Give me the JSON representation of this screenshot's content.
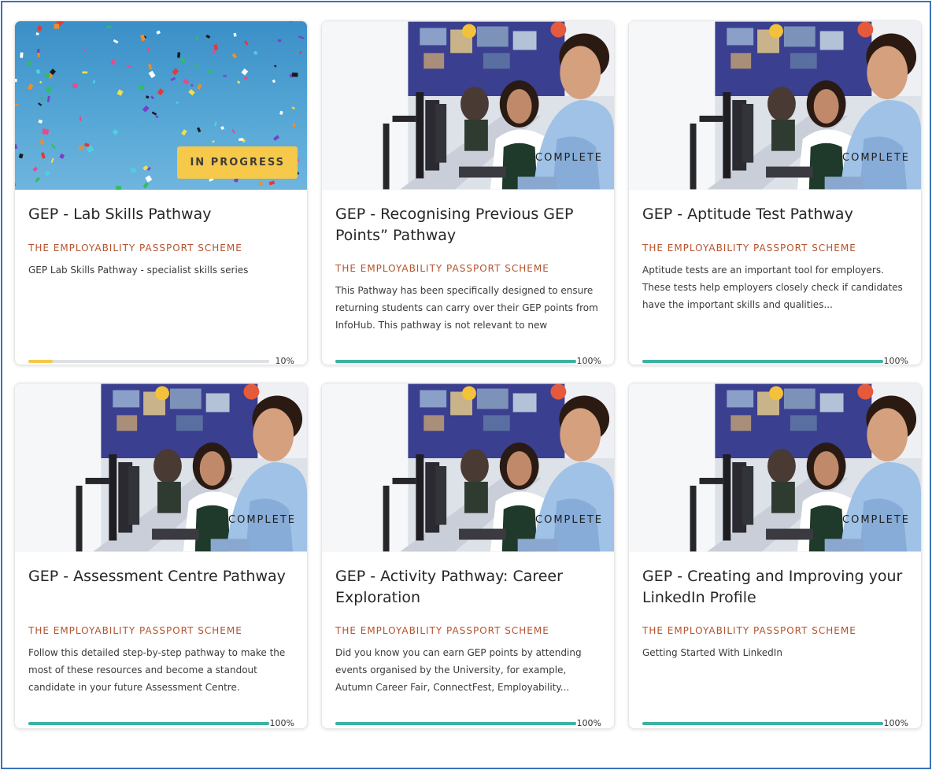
{
  "colors": {
    "progress_partial": "#f6c94a",
    "progress_complete": "#3bb3a3",
    "provider": "#b5532e",
    "frame": "#3b73b9"
  },
  "cards": [
    {
      "title": "GEP - Lab Skills Pathway",
      "provider": "THE EMPLOYABILITY PASSPORT SCHEME",
      "description": "GEP Lab Skills Pathway - specialist skills series",
      "status": "IN PROGRESS",
      "progress": 10,
      "progress_label": "10%",
      "image": "confetti-image"
    },
    {
      "title": "GEP - Recognising Previous GEP Points” Pathway",
      "provider": "THE EMPLOYABILITY PASSPORT SCHEME",
      "description": "This Pathway has been specifically designed to ensure returning students can carry over their GEP points from InfoHub. This pathway is not relevant to new students...",
      "status": "COMPLETE",
      "progress": 100,
      "progress_label": "100%",
      "image": "students-computer-image"
    },
    {
      "title": "GEP - Aptitude Test Pathway",
      "provider": "THE EMPLOYABILITY PASSPORT SCHEME",
      "description": "Aptitude tests are an important tool for employers. These tests help employers closely check if candidates have the important skills and qualities...",
      "status": "COMPLETE",
      "progress": 100,
      "progress_label": "100%",
      "image": "students-computer-image"
    },
    {
      "title": "GEP - Assessment Centre Pathway",
      "provider": "THE EMPLOYABILITY PASSPORT SCHEME",
      "description": "Follow this detailed step-by-step pathway to make the most of these resources and become a standout candidate in your future Assessment Centre.",
      "status": "COMPLETE",
      "progress": 100,
      "progress_label": "100%",
      "image": "students-computer-image"
    },
    {
      "title": "GEP - Activity Pathway: Career Exploration",
      "provider": "THE EMPLOYABILITY PASSPORT SCHEME",
      "description": "Did you know you can earn GEP points by attending events organised by the University, for example, Autumn Career Fair, ConnectFest, Employability...",
      "status": "COMPLETE",
      "progress": 100,
      "progress_label": "100%",
      "image": "students-computer-image"
    },
    {
      "title": "GEP - Creating and Improving your LinkedIn Profile",
      "provider": "THE EMPLOYABILITY PASSPORT SCHEME",
      "description": "Getting Started With LinkedIn",
      "status": "COMPLETE",
      "progress": 100,
      "progress_label": "100%",
      "image": "students-computer-image"
    }
  ]
}
